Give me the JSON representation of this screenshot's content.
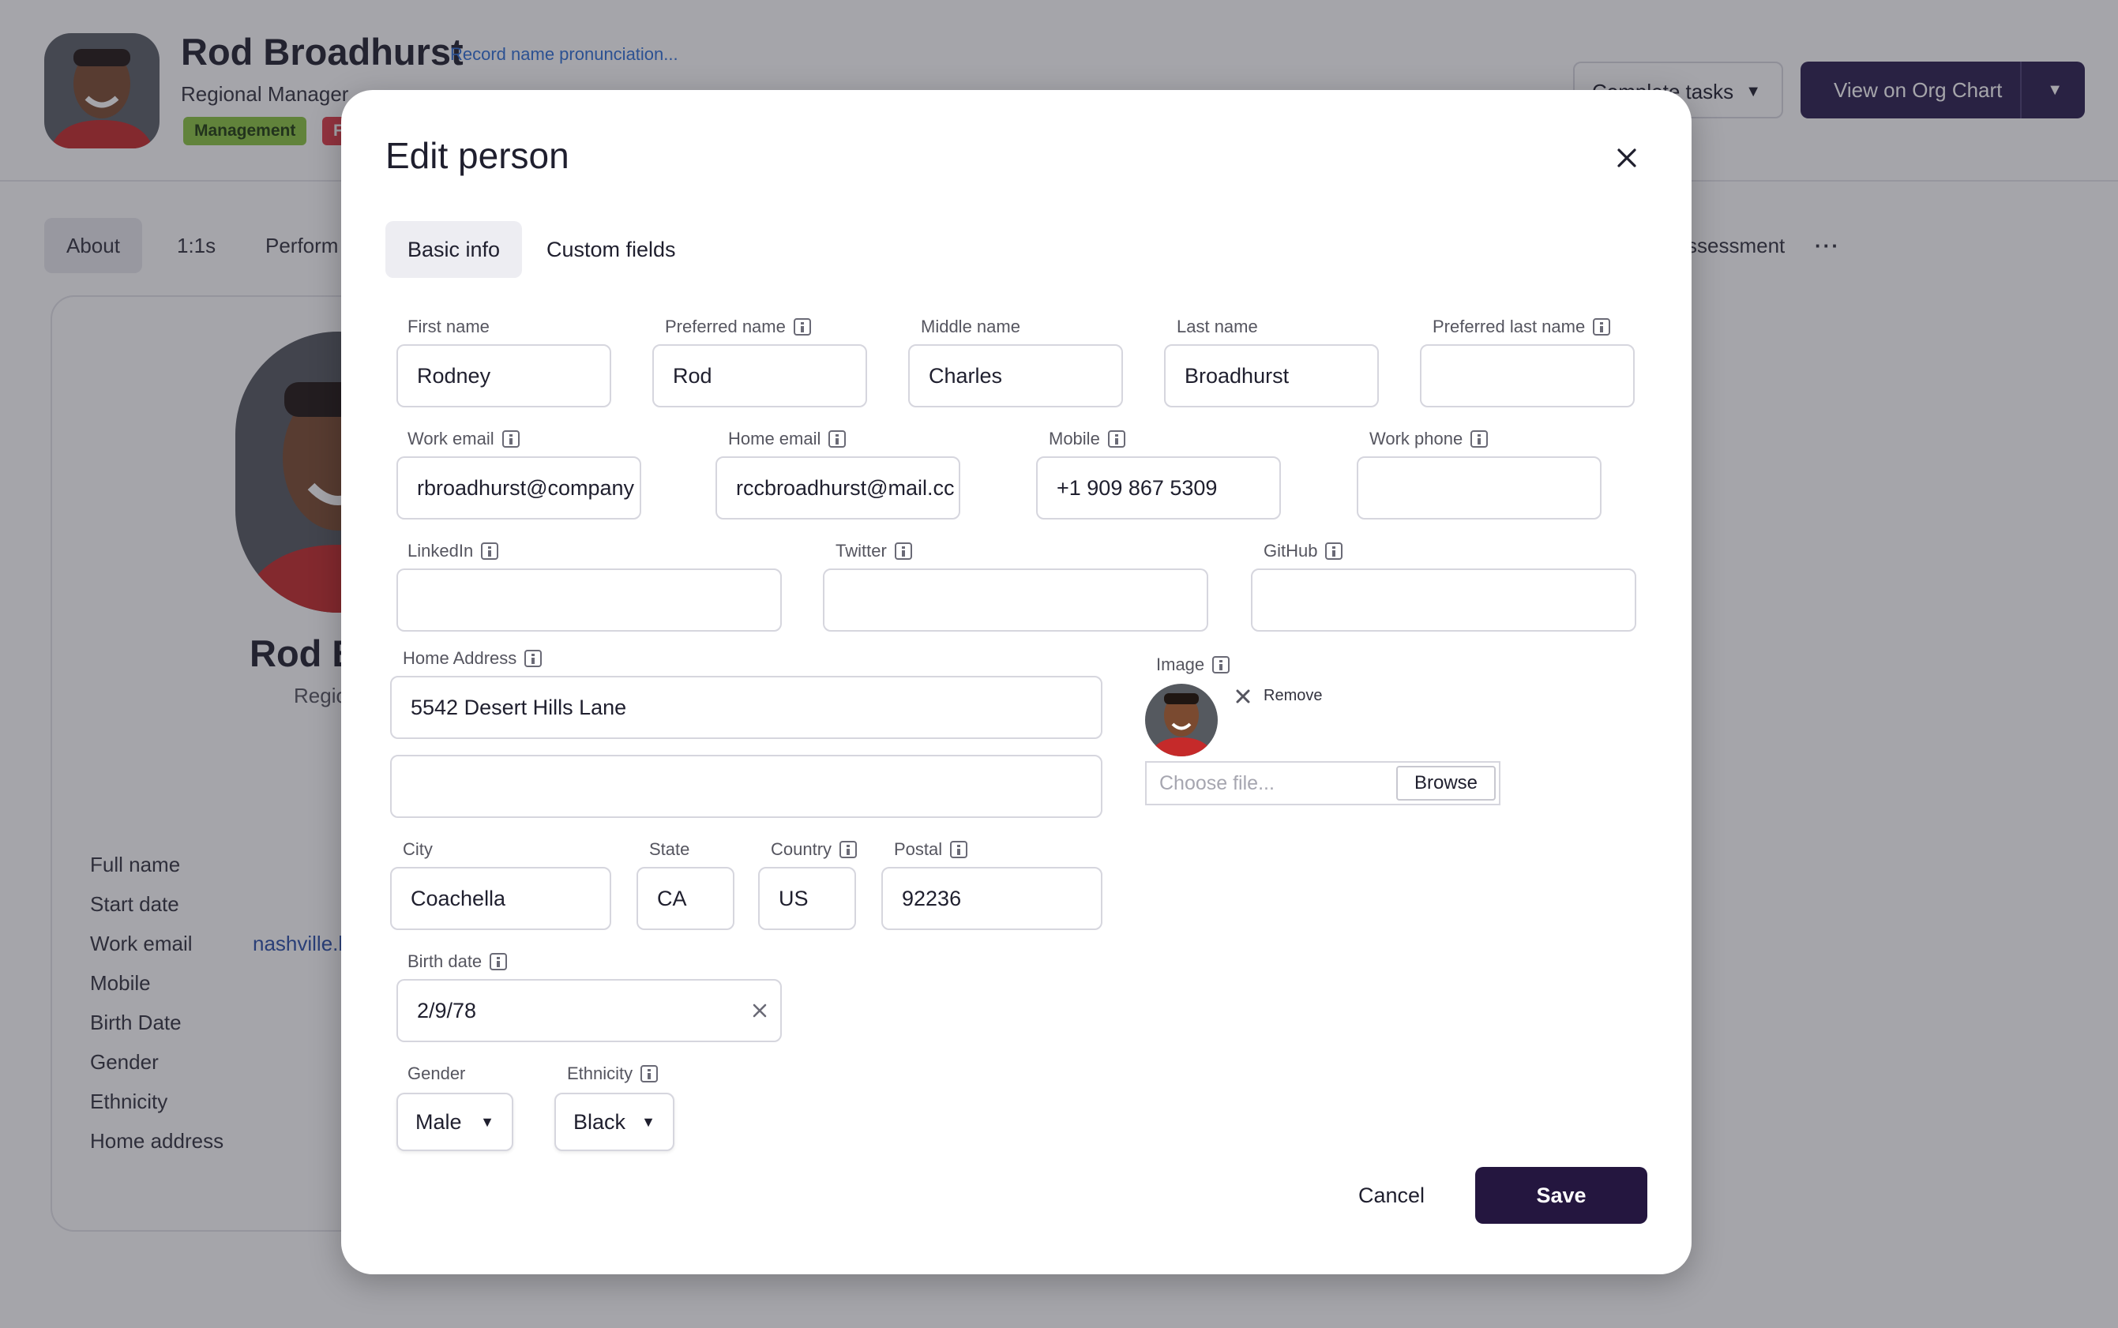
{
  "background": {
    "person": {
      "name": "Rod Broadhurst",
      "pronunciation_link": "Record name pronunciation...",
      "title": "Regional Manager",
      "tags": [
        "Management",
        "F"
      ]
    },
    "header_buttons": {
      "complete_tasks": "Complete tasks",
      "view_org_chart": "View on Org Chart"
    },
    "tabs": {
      "about": "About",
      "one_on_ones": "1:1s",
      "performance": "Perform",
      "assessment": "ssessment",
      "more": "···"
    },
    "card": {
      "name": "Rod B",
      "role": "Regio",
      "fields": [
        {
          "label": "Full name",
          "value": ""
        },
        {
          "label": "Start date",
          "value": ""
        },
        {
          "label": "Work email",
          "value": "nashville.b"
        },
        {
          "label": "Mobile",
          "value": ""
        },
        {
          "label": "Birth Date",
          "value": ""
        },
        {
          "label": "Gender",
          "value": ""
        },
        {
          "label": "Ethnicity",
          "value": ""
        },
        {
          "label": "Home address",
          "value": ""
        }
      ]
    }
  },
  "modal": {
    "title": "Edit person",
    "tabs": {
      "basic_info": "Basic info",
      "custom_fields": "Custom fields"
    },
    "fields": {
      "first_name": {
        "label": "First name",
        "value": "Rodney"
      },
      "preferred_name": {
        "label": "Preferred name",
        "value": "Rod"
      },
      "middle_name": {
        "label": "Middle name",
        "value": "Charles"
      },
      "last_name": {
        "label": "Last name",
        "value": "Broadhurst"
      },
      "preferred_last_name": {
        "label": "Preferred last name",
        "value": ""
      },
      "work_email": {
        "label": "Work email",
        "value": "rbroadhurst@company"
      },
      "home_email": {
        "label": "Home email",
        "value": "rccbroadhurst@mail.cc"
      },
      "mobile": {
        "label": "Mobile",
        "value": "+1 909 867 5309"
      },
      "work_phone": {
        "label": "Work phone",
        "value": ""
      },
      "linkedin": {
        "label": "LinkedIn",
        "value": ""
      },
      "twitter": {
        "label": "Twitter",
        "value": ""
      },
      "github": {
        "label": "GitHub",
        "value": ""
      },
      "home_address": {
        "label": "Home Address",
        "line1": "5542 Desert Hills Lane",
        "line2": ""
      },
      "image": {
        "label": "Image",
        "remove": "Remove",
        "file_placeholder": "Choose file...",
        "browse": "Browse"
      },
      "city": {
        "label": "City",
        "value": "Coachella"
      },
      "state": {
        "label": "State",
        "value": "CA"
      },
      "country": {
        "label": "Country",
        "value": "US"
      },
      "postal": {
        "label": "Postal",
        "value": "92236"
      },
      "birth_date": {
        "label": "Birth date",
        "value": "2/9/78"
      },
      "gender": {
        "label": "Gender",
        "value": "Male"
      },
      "ethnicity": {
        "label": "Ethnicity",
        "value": "Black"
      }
    },
    "buttons": {
      "cancel": "Cancel",
      "save": "Save"
    }
  },
  "colors": {
    "primary": "#24163f",
    "link": "#2f6fd6",
    "tag_green": "#8bc540",
    "tag_red": "#e03c48"
  }
}
